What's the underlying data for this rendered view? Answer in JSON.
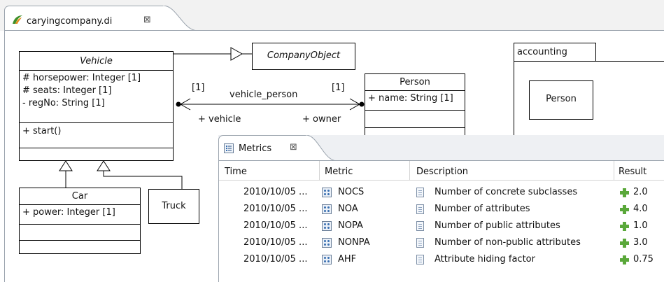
{
  "editor": {
    "tab_title": "caryingcompany.di",
    "close_glyph": "⊠"
  },
  "diagram": {
    "vehicle": {
      "name": "Vehicle",
      "attributes": [
        "# horsepower: Integer [1]",
        "# seats: Integer [1]",
        "- regNo: String [1]"
      ],
      "operations": [
        "+ start()"
      ]
    },
    "company_object": {
      "name": "CompanyObject"
    },
    "person": {
      "name": "Person",
      "attributes": [
        "+ name: String [1]"
      ]
    },
    "car": {
      "name": "Car",
      "attributes": [
        "+ power: Integer [1]"
      ]
    },
    "truck": {
      "name": "Truck"
    },
    "association": {
      "name": "vehicle_person",
      "left_mult": "[1]",
      "right_mult": "[1]",
      "left_role": "+ vehicle",
      "right_role": "+ owner"
    },
    "package": {
      "name": "accounting",
      "inner_class": "Person"
    }
  },
  "metrics_view": {
    "tab_title": "Metrics",
    "close_glyph": "⊠",
    "columns": {
      "time": "Time",
      "metric": "Metric",
      "description": "Description",
      "result": "Result"
    },
    "rows": [
      {
        "time": "2010/10/05 ...",
        "metric": "NOCS",
        "description": "Number of concrete subclasses",
        "result": "2.0"
      },
      {
        "time": "2010/10/05 ...",
        "metric": "NOA",
        "description": "Number of attributes",
        "result": "4.0"
      },
      {
        "time": "2010/10/05 ...",
        "metric": "NOPA",
        "description": "Number of public attributes",
        "result": "1.0"
      },
      {
        "time": "2010/10/05 ...",
        "metric": "NONPA",
        "description": "Number of non-public attributes",
        "result": "3.0"
      },
      {
        "time": "2010/10/05 ...",
        "metric": "AHF",
        "description": "Attribute hiding factor",
        "result": "0.75"
      }
    ]
  },
  "colors": {
    "border": "#9aa3ad",
    "plus": "#5aa83a",
    "eclipse_green": "#3e8f2a",
    "eclipse_orange": "#e38b1b"
  }
}
